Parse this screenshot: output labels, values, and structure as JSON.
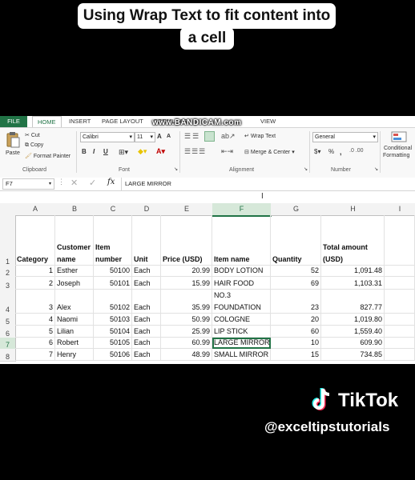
{
  "caption": {
    "line1": "Using Wrap Text to fit content into",
    "line2": "a cell"
  },
  "tabs": {
    "file": "FILE",
    "home": "HOME",
    "insert": "INSERT",
    "page_layout": "PAGE LAYOUT",
    "formulas": "FORMULAS",
    "view": "VIEW",
    "watermark": "www.BANDICAM.com"
  },
  "ribbon": {
    "clipboard": {
      "paste": "Paste",
      "cut": "Cut",
      "copy": "Copy",
      "format_painter": "Format Painter",
      "label": "Clipboard"
    },
    "font": {
      "name": "Calibri",
      "size": "11",
      "grow": "A",
      "shrink": "A",
      "bold": "B",
      "italic": "I",
      "underline": "U",
      "label": "Font"
    },
    "alignment": {
      "wrap_text": "Wrap Text",
      "merge_center": "Merge & Center",
      "label": "Alignment"
    },
    "number": {
      "format": "General",
      "currency": "$",
      "percent": "%",
      "comma": ",",
      "label": "Number"
    },
    "styles": {
      "conditional": "Conditional",
      "formatting": "Formatting"
    }
  },
  "formula_bar": {
    "name_box": "F7",
    "fx": "fx",
    "content": "LARGE MIRROR"
  },
  "sheet": {
    "columns": [
      "A",
      "B",
      "C",
      "D",
      "E",
      "F",
      "G",
      "H",
      "I"
    ],
    "rows": [
      "1",
      "2",
      "3",
      "4",
      "5",
      "6",
      "7",
      "8"
    ],
    "header": [
      "Category",
      "Customer name",
      "Item number",
      "Unit",
      "Price (USD)",
      "Item name",
      "Quantity",
      "Total amount (USD)"
    ],
    "data": [
      [
        "1",
        "Esther",
        "50100",
        "Each",
        "20.99",
        "BODY LOTION",
        "52",
        "1,091.48"
      ],
      [
        "2",
        "Joseph",
        "50101",
        "Each",
        "15.99",
        "HAIR FOOD",
        "69",
        "1,103.31"
      ],
      [
        "3",
        "Alex",
        "50102",
        "Each",
        "35.99",
        "NO.3 FOUNDATION",
        "23",
        "827.77"
      ],
      [
        "4",
        "Naomi",
        "50103",
        "Each",
        "50.99",
        "ARABIC COLOGNE",
        "20",
        "1,019.80"
      ],
      [
        "5",
        "Lilian",
        "50104",
        "Each",
        "25.99",
        "LIP STICK",
        "60",
        "1,559.40"
      ],
      [
        "6",
        "Robert",
        "50105",
        "Each",
        "60.99",
        "LARGE MIRROR",
        "10",
        "609.90"
      ],
      [
        "7",
        "Henry",
        "50106",
        "Each",
        "48.99",
        "SMALL MIRROR",
        "15",
        "734.85"
      ]
    ]
  },
  "branding": {
    "tiktok": "TikTok",
    "handle": "@exceltipstutorials"
  }
}
